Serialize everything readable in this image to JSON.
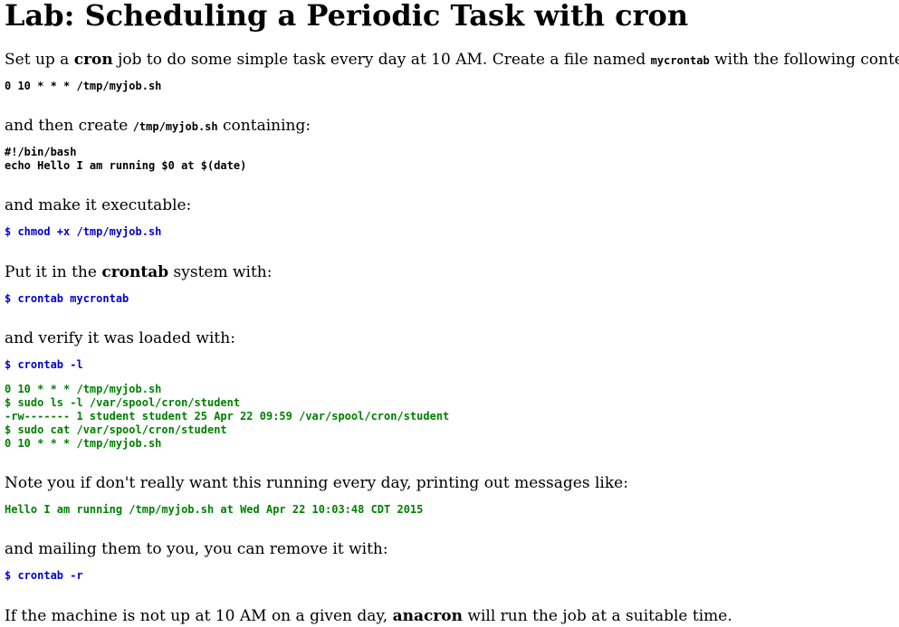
{
  "title": "Lab: Scheduling a Periodic Task with cron",
  "p1": {
    "a": "Set up a ",
    "b": "cron",
    "c": " job to do some simple task every day at 10 AM. Create a file named ",
    "d": "mycrontab",
    "e": " with the following content:"
  },
  "code1": "0 10 * * * /tmp/myjob.sh",
  "p2": {
    "a": "and then create ",
    "b": "/tmp/myjob.sh",
    "c": " containing:"
  },
  "code2": [
    "#!/bin/bash",
    "echo Hello I am running $0 at $(date)"
  ],
  "p3": "and make it executable:",
  "cmd1": "$ chmod +x /tmp/myjob.sh",
  "p4": {
    "a": "Put it in the ",
    "b": "crontab",
    "c": " system with:"
  },
  "cmd2": "$ crontab mycrontab",
  "p5": "and verify it was loaded with:",
  "cmd3": "$ crontab -l",
  "out1": [
    "0 10 * * * /tmp/myjob.sh",
    "$ sudo ls -l /var/spool/cron/student",
    "-rw------- 1 student student 25 Apr 22 09:59 /var/spool/cron/student",
    "$ sudo cat /var/spool/cron/student",
    "0 10 * * * /tmp/myjob.sh"
  ],
  "p6": "Note you if don't really want this running every day, printing out messages like:",
  "out2": "Hello I am running /tmp/myjob.sh at Wed Apr 22 10:03:48 CDT 2015",
  "p7": "and mailing them to you, you can remove it with:",
  "cmd4": "$ crontab -r",
  "p8": {
    "a": "If the machine is not up at 10 AM on a given day, ",
    "b": "anacron",
    "c": " will run the job at a suitable time."
  },
  "colors": {
    "command": "#0000cc",
    "output": "#008000",
    "text": "#000000"
  }
}
